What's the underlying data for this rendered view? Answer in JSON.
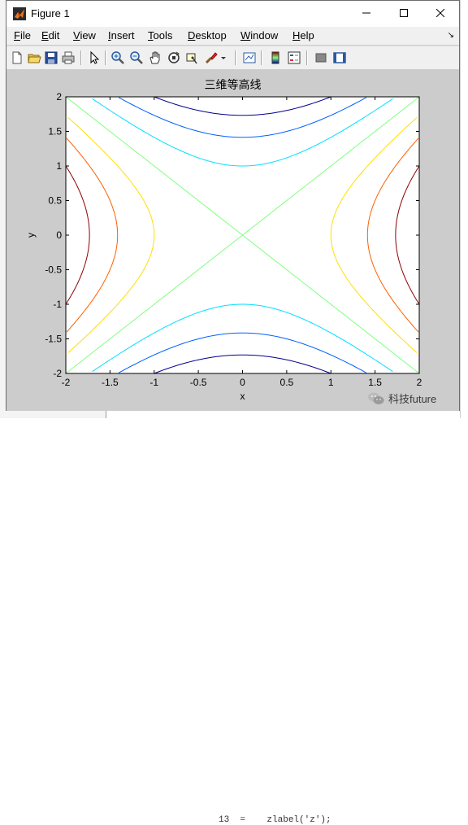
{
  "window": {
    "title": "Figure 1"
  },
  "menu": [
    {
      "label": "File",
      "u": "F",
      "rest": "ile"
    },
    {
      "label": "Edit",
      "u": "E",
      "rest": "dit"
    },
    {
      "label": "View",
      "u": "V",
      "rest": "iew"
    },
    {
      "label": "Insert",
      "u": "I",
      "rest": "nsert"
    },
    {
      "label": "Tools",
      "u": "T",
      "rest": "ools"
    },
    {
      "label": "Desktop",
      "u": "D",
      "rest": "esktop"
    },
    {
      "label": "Window",
      "u": "W",
      "rest": "indow"
    },
    {
      "label": "Help",
      "u": "H",
      "rest": "elp"
    }
  ],
  "toolbar_icons": [
    "new-figure-icon",
    "open-file-icon",
    "save-icon",
    "print-icon",
    "edit-plot-arrow-icon",
    "zoom-in-icon",
    "zoom-out-icon",
    "pan-hand-icon",
    "rotate-3d-icon",
    "data-cursor-icon",
    "brush-icon",
    "brush-dropdown-icon",
    "link-plot-icon",
    "colorbar-icon",
    "legend-icon",
    "hide-plot-tools-icon",
    "show-plot-tools-icon"
  ],
  "background_code": {
    "line_no": "13",
    "text": "zlabel('z');"
  },
  "watermark": {
    "text": "科技future"
  },
  "colors": {
    "window_bg": "#cccccc",
    "level_colors": [
      "#00008f",
      "#0060ff",
      "#00dfff",
      "#7fff7f",
      "#ffdf00",
      "#ff5f00",
      "#8f0000"
    ]
  },
  "chart_data": {
    "type": "contour",
    "function": "z = x^2 - y^2",
    "title": "三维等高线",
    "xlabel": "x",
    "ylabel": "y",
    "xlim": [
      -2,
      2
    ],
    "ylim": [
      -2,
      2
    ],
    "xticks": [
      "-2",
      "-1.5",
      "-1",
      "-0.5",
      "0",
      "0.5",
      "1",
      "1.5",
      "2"
    ],
    "yticks": [
      "2",
      "1.5",
      "1",
      "0.5",
      "0",
      "-0.5",
      "-1",
      "-1.5",
      "-2"
    ],
    "levels": [
      -3,
      -2,
      -1,
      0,
      1,
      2,
      3
    ],
    "grid": false,
    "legend": "none"
  }
}
